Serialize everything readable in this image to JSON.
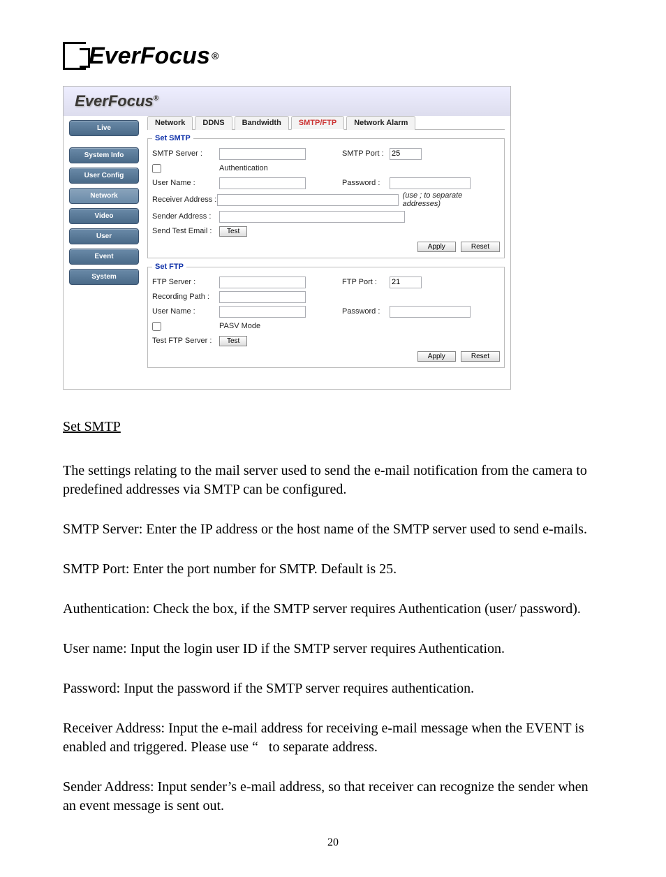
{
  "logo_text": "EverFocus",
  "sidebar": [
    {
      "label": "Live"
    },
    {
      "label": "System Info"
    },
    {
      "label": "User Config"
    },
    {
      "label": "Network"
    },
    {
      "label": "Video"
    },
    {
      "label": "User"
    },
    {
      "label": "Event"
    },
    {
      "label": "System"
    }
  ],
  "tabs": [
    {
      "label": "Network"
    },
    {
      "label": "DDNS"
    },
    {
      "label": "Bandwidth"
    },
    {
      "label": "SMTP/FTP",
      "sel": true
    },
    {
      "label": "Network Alarm"
    }
  ],
  "smtp": {
    "legend": "Set SMTP",
    "server_lbl": "SMTP Server :",
    "auth_lbl": "Authentication",
    "port_lbl": "SMTP Port :",
    "port_val": "25",
    "user_lbl": "User Name :",
    "pass_lbl": "Password :",
    "recv_lbl": "Receiver Address :",
    "recv_note": "(use ; to separate addresses)",
    "sender_lbl": "Sender Address :",
    "send_test_lbl": "Send Test Email :",
    "test_btn": "Test",
    "apply": "Apply",
    "reset": "Reset"
  },
  "ftp": {
    "legend": "Set FTP",
    "server_lbl": "FTP Server :",
    "port_lbl": "FTP Port :",
    "port_val": "21",
    "rec_path_lbl": "Recording Path :",
    "user_lbl": "User Name :",
    "pass_lbl": "Password :",
    "pasv_lbl": "PASV Mode",
    "test_lbl": "Test FTP Server :",
    "test_btn": "Test",
    "apply": "Apply",
    "reset": "Reset"
  },
  "doc": {
    "h": "Set SMTP",
    "p1": "The settings relating to the mail server used to send the e-mail notification from the camera to predefined addresses via SMTP can be configured.",
    "p2": "SMTP Server: Enter the IP address or the host name of the SMTP server used to send e-mails.",
    "p3": "SMTP Port: Enter the port number for SMTP. Default is 25.",
    "p4": "Authentication: Check the box, if the SMTP server requires Authentication (user/ password).",
    "p5": "User name: Input the login user ID if the SMTP server requires Authentication.",
    "p6": "Password: Input the password if the SMTP server requires authentication.",
    "p7": "Receiver Address: Input the e-mail address for receiving e-mail message when the EVENT is enabled and triggered. Please use “   to separate address.",
    "p8": "Sender Address: Input sender’s e-mail address, so that receiver can recognize the sender when an event message is sent out.",
    "page": "20"
  }
}
